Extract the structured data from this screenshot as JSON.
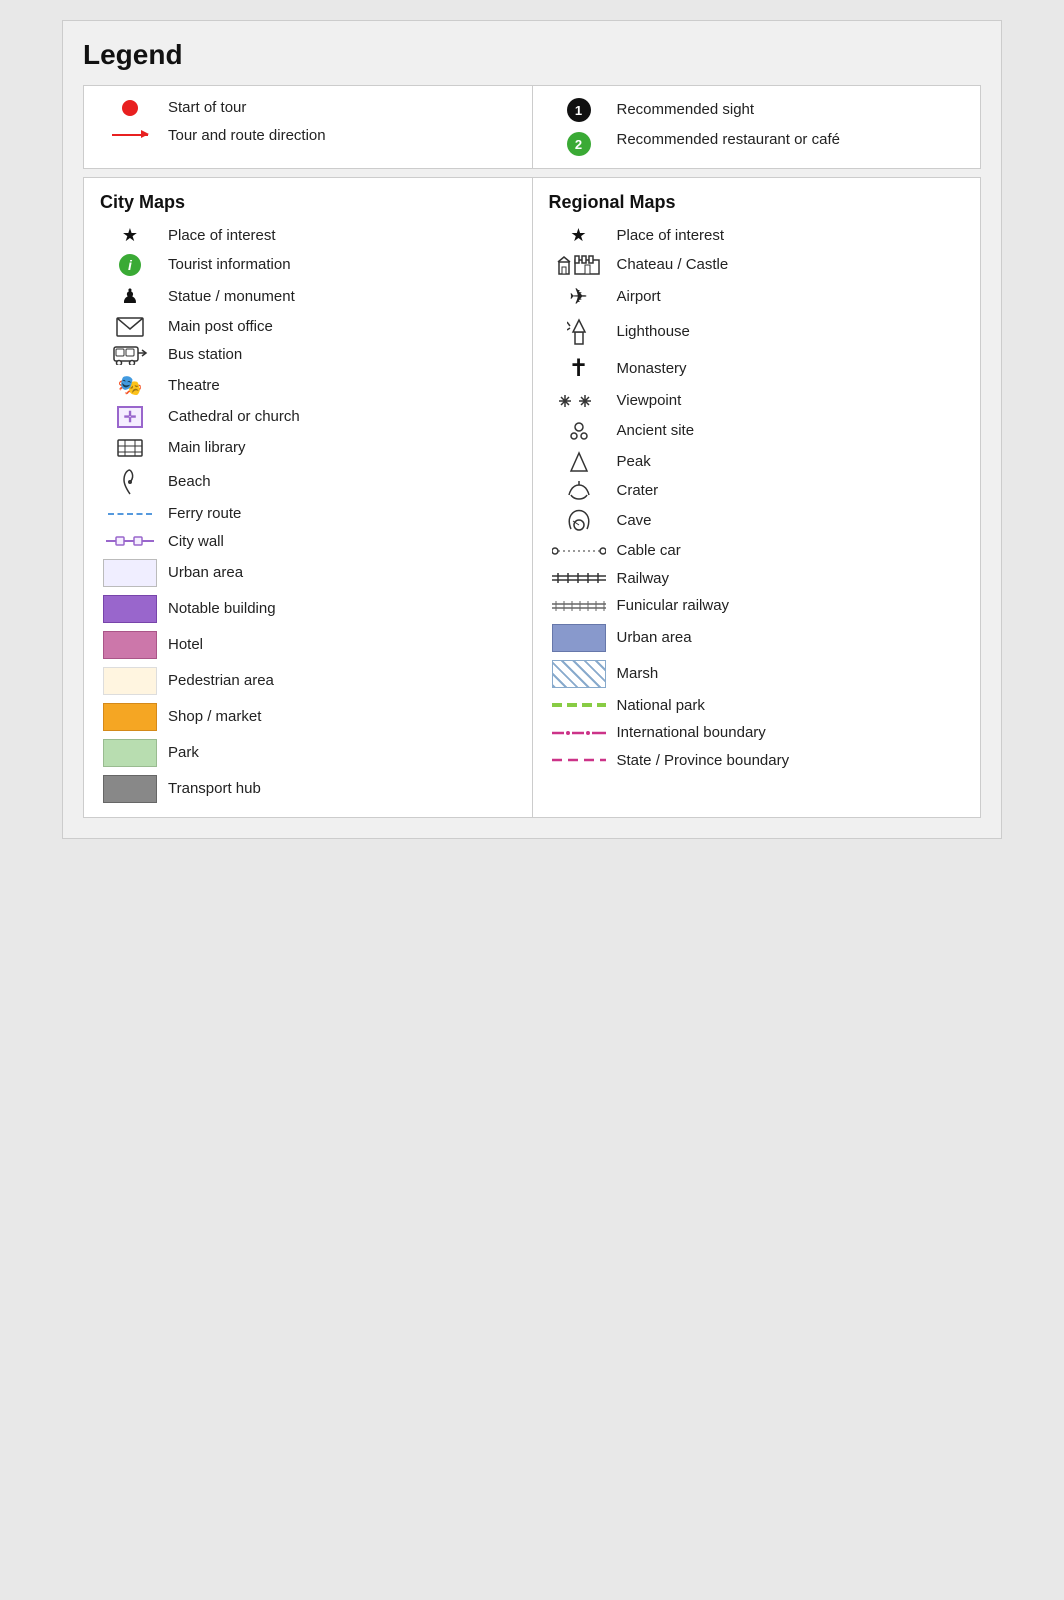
{
  "title": "Legend",
  "top_left": [
    {
      "id": "start-of-tour",
      "icon": "red-dot",
      "label": "Start of tour"
    },
    {
      "id": "route-direction",
      "icon": "red-arrow",
      "label": "Tour and route direction"
    }
  ],
  "top_right": [
    {
      "id": "recommended-sight",
      "icon": "num-1",
      "label": "Recommended sight"
    },
    {
      "id": "recommended-restaurant",
      "icon": "num-2",
      "label": "Recommended restaurant or café"
    }
  ],
  "city_maps": {
    "header": "City Maps",
    "items": [
      {
        "id": "place-interest-city",
        "icon": "star",
        "label": "Place of interest"
      },
      {
        "id": "tourist-info",
        "icon": "green-info",
        "label": "Tourist information"
      },
      {
        "id": "statue-monument",
        "icon": "chess-pawn",
        "label": "Statue / monument"
      },
      {
        "id": "main-post-office",
        "icon": "envelope",
        "label": "Main post office"
      },
      {
        "id": "bus-station",
        "icon": "bus",
        "label": "Bus station"
      },
      {
        "id": "theatre",
        "icon": "theatre",
        "label": "Theatre"
      },
      {
        "id": "cathedral-church",
        "icon": "church-box",
        "label": "Cathedral or church"
      },
      {
        "id": "main-library",
        "icon": "library",
        "label": "Main library"
      },
      {
        "id": "beach",
        "icon": "beach",
        "label": "Beach"
      },
      {
        "id": "ferry-route",
        "icon": "ferry-dashed",
        "label": "Ferry route"
      },
      {
        "id": "city-wall",
        "icon": "city-wall",
        "label": "City wall"
      },
      {
        "id": "urban-area-city",
        "icon": "urban-area-city-box",
        "label": "Urban area"
      },
      {
        "id": "notable-building",
        "icon": "notable-building-box",
        "label": "Notable building"
      },
      {
        "id": "hotel",
        "icon": "hotel-box",
        "label": "Hotel"
      },
      {
        "id": "pedestrian-area",
        "icon": "pedestrian-area-box",
        "label": "Pedestrian area"
      },
      {
        "id": "shop-market",
        "icon": "shop-market-box",
        "label": "Shop / market"
      },
      {
        "id": "park",
        "icon": "park-box",
        "label": "Park"
      },
      {
        "id": "transport-hub",
        "icon": "transport-hub-box",
        "label": "Transport hub"
      }
    ]
  },
  "regional_maps": {
    "header": "Regional Maps",
    "items": [
      {
        "id": "place-interest-regional",
        "icon": "star",
        "label": "Place of interest"
      },
      {
        "id": "chateau-castle",
        "icon": "chateau",
        "label": "Chateau / Castle"
      },
      {
        "id": "airport",
        "icon": "airplane",
        "label": "Airport"
      },
      {
        "id": "lighthouse",
        "icon": "lighthouse",
        "label": "Lighthouse"
      },
      {
        "id": "monastery",
        "icon": "cross",
        "label": "Monastery"
      },
      {
        "id": "viewpoint",
        "icon": "viewpoint",
        "label": "Viewpoint"
      },
      {
        "id": "ancient-site",
        "icon": "ancient",
        "label": "Ancient site"
      },
      {
        "id": "peak",
        "icon": "peak",
        "label": "Peak"
      },
      {
        "id": "crater",
        "icon": "crater",
        "label": "Crater"
      },
      {
        "id": "cave",
        "icon": "cave",
        "label": "Cave"
      },
      {
        "id": "cable-car",
        "icon": "cable-car-line",
        "label": "Cable car"
      },
      {
        "id": "railway",
        "icon": "railway-line",
        "label": "Railway"
      },
      {
        "id": "funicular-railway",
        "icon": "funicular-line",
        "label": "Funicular railway"
      },
      {
        "id": "urban-area-regional",
        "icon": "urban-area-regional-box",
        "label": "Urban area"
      },
      {
        "id": "marsh",
        "icon": "marsh-box",
        "label": "Marsh"
      },
      {
        "id": "national-park",
        "icon": "national-park-line",
        "label": "National park"
      },
      {
        "id": "international-boundary",
        "icon": "intl-boundary-line",
        "label": "International boundary"
      },
      {
        "id": "state-province-boundary",
        "icon": "state-boundary-line",
        "label": "State / Province boundary"
      }
    ]
  }
}
